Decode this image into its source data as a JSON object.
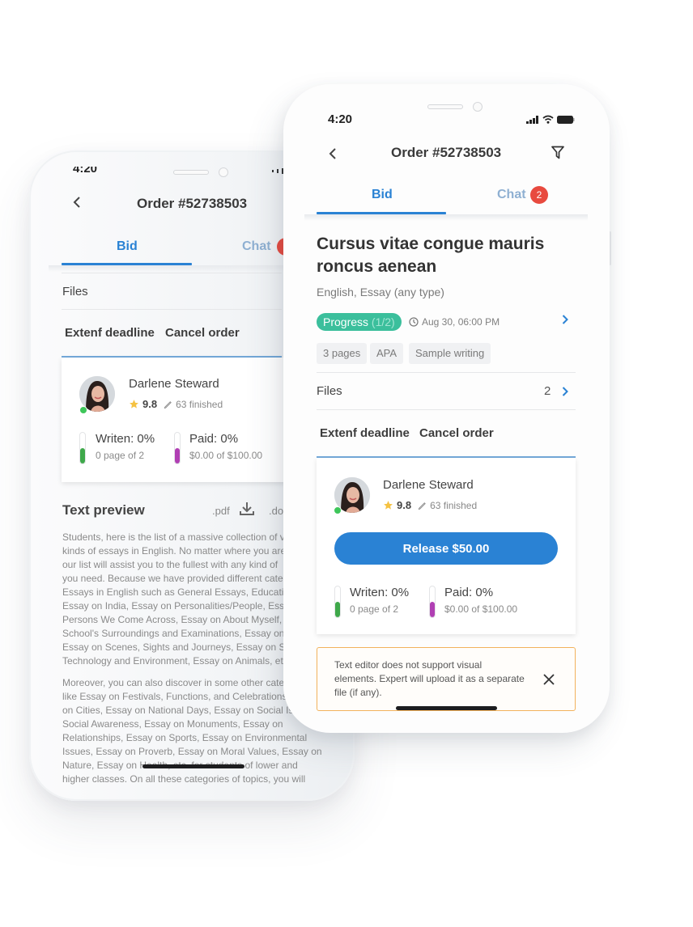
{
  "status_bar": {
    "time": "4:20"
  },
  "nav": {
    "title": "Order #52738503",
    "back_icon": "chevron-left-icon",
    "filter_icon": "filter-icon"
  },
  "tabs": [
    {
      "label": "Bid",
      "active": true
    },
    {
      "label": "Chat",
      "badge": "2"
    }
  ],
  "order": {
    "title_line1": "Cursus vitae congue mauris",
    "title_line2": "roncus aenean",
    "subtitle": "English, Essay (any type)",
    "status_label": "Progress",
    "status_fraction": "(1/2)",
    "status_color": "#3bbf9c",
    "deadline": "Aug 30, 06:00 PM",
    "tags": [
      "3 pages",
      "APA",
      "Sample writing"
    ]
  },
  "files": {
    "label": "Files",
    "count": "2"
  },
  "actions": {
    "extend": "Extenf deadline",
    "cancel": "Cancel order"
  },
  "expert": {
    "name": "Darlene Steward",
    "rating": "9.8",
    "finished": "63 finished",
    "online": true
  },
  "release_button": "Release $50.00",
  "stats": {
    "written": {
      "title": "Writen: 0%",
      "sub": "0 page of 2",
      "color": "#3ea84a",
      "percent": 0
    },
    "paid": {
      "title": "Paid: 0%",
      "sub": "$0.00 of $100.00",
      "color": "#b03fb3",
      "percent": 0
    }
  },
  "notice": {
    "lines": [
      "Text editor does not support visual",
      "elements. Expert will upload it as a separate",
      "file (if any)."
    ]
  },
  "text_preview": {
    "title": "Text preview",
    "formats": [
      ".pdf",
      ".do"
    ],
    "paragraph1": [
      "Students, here is the list of a massive collection of v",
      "kinds of essays in English. No matter where you are",
      "our list will assist you to the fullest with any kind of",
      "you need. Because we have provided different cate",
      "Essays in English such as General Essays, Education",
      "Essay on India, Essay on Personalities/People, Essay",
      "Persons We Come Across, Essay on About Myself, E",
      "School's Surroundings and Examinations, Essay on V",
      "Essay on Scenes, Sights and Journeys, Essay on Scie",
      "Technology and Environment, Essay on Animals, etc"
    ],
    "paragraph2": [
      "Moreover, you can also discover in some other cate",
      "like Essay on Festivals, Functions, and Celebrations,",
      "on Cities, Essay on National Days, Essay on Social Issu",
      "Social Awareness, Essay on Monuments, Essay on",
      "Relationships, Essay on Sports, Essay on Environmental",
      "Issues, Essay on Proverb, Essay on Moral Values, Essay on",
      "Nature, Essay on Health, etc. for students of lower and",
      "higher classes. On all these categories of topics, you will"
    ]
  },
  "colors": {
    "accent": "#2a82d4",
    "badge": "#e84a3f",
    "notice_border": "#f2b25c",
    "online": "#3ec65a"
  }
}
